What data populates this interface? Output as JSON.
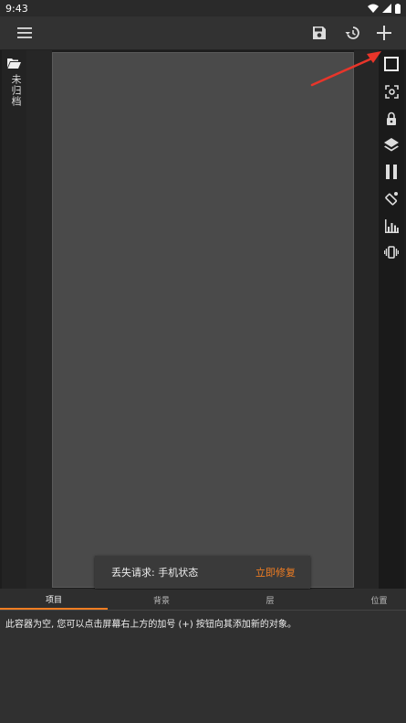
{
  "status": {
    "time": "9:43"
  },
  "left_panel": {
    "label": "未归档"
  },
  "snackbar": {
    "message": "丢失请求: 手机状态",
    "action": "立即修复"
  },
  "tabs": [
    {
      "label": "项目"
    },
    {
      "label": "背景"
    },
    {
      "label": "层"
    },
    {
      "label": "位置"
    }
  ],
  "content": {
    "empty_message": "此容器为空, 您可以点击屏幕右上方的加号 (+) 按钮向其添加新的对象。"
  },
  "colors": {
    "accent": "#f07d22",
    "arrow": "#e8352a"
  }
}
